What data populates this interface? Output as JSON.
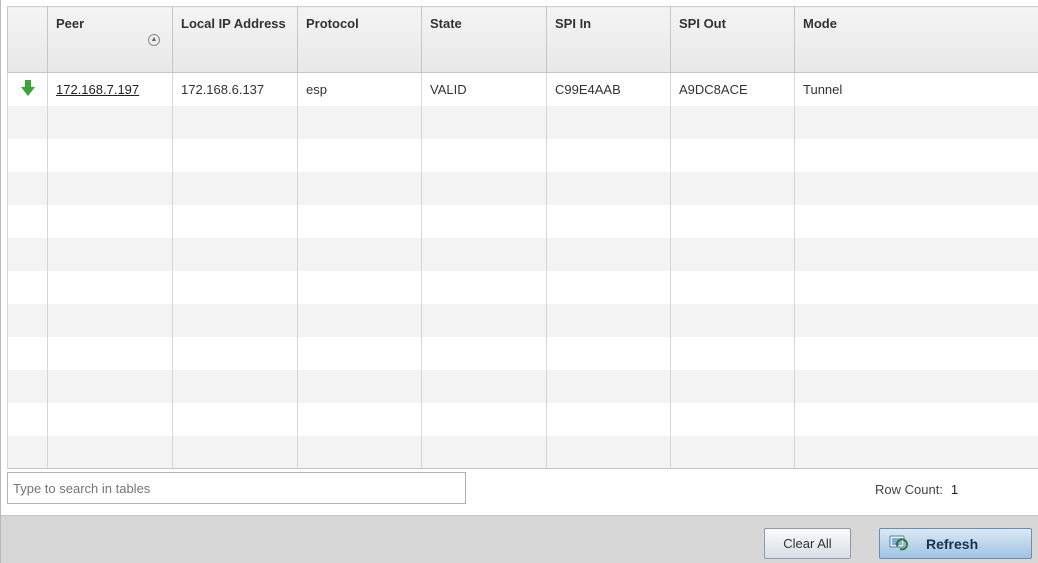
{
  "table": {
    "headers": [
      "Peer",
      "Local IP Address",
      "Protocol",
      "State",
      "SPI In",
      "SPI Out",
      "Mode"
    ],
    "rows": [
      {
        "status_icon": "green-arrow-down-icon",
        "peer": "172.168.7.197",
        "local_ip": "172.168.6.137",
        "protocol": "esp",
        "state": "VALID",
        "spi_in": "C99E4AAB",
        "spi_out": "A9DC8ACE",
        "mode": "Tunnel"
      }
    ]
  },
  "search": {
    "placeholder": "Type to search in tables"
  },
  "row_count": {
    "label": "Row Count:",
    "value": "1"
  },
  "footer": {
    "clear_label": "Clear All",
    "refresh_label": "Refresh"
  },
  "colors": {
    "status_green": "#3aa33a",
    "refresh_blue": "#9ec3e3"
  }
}
